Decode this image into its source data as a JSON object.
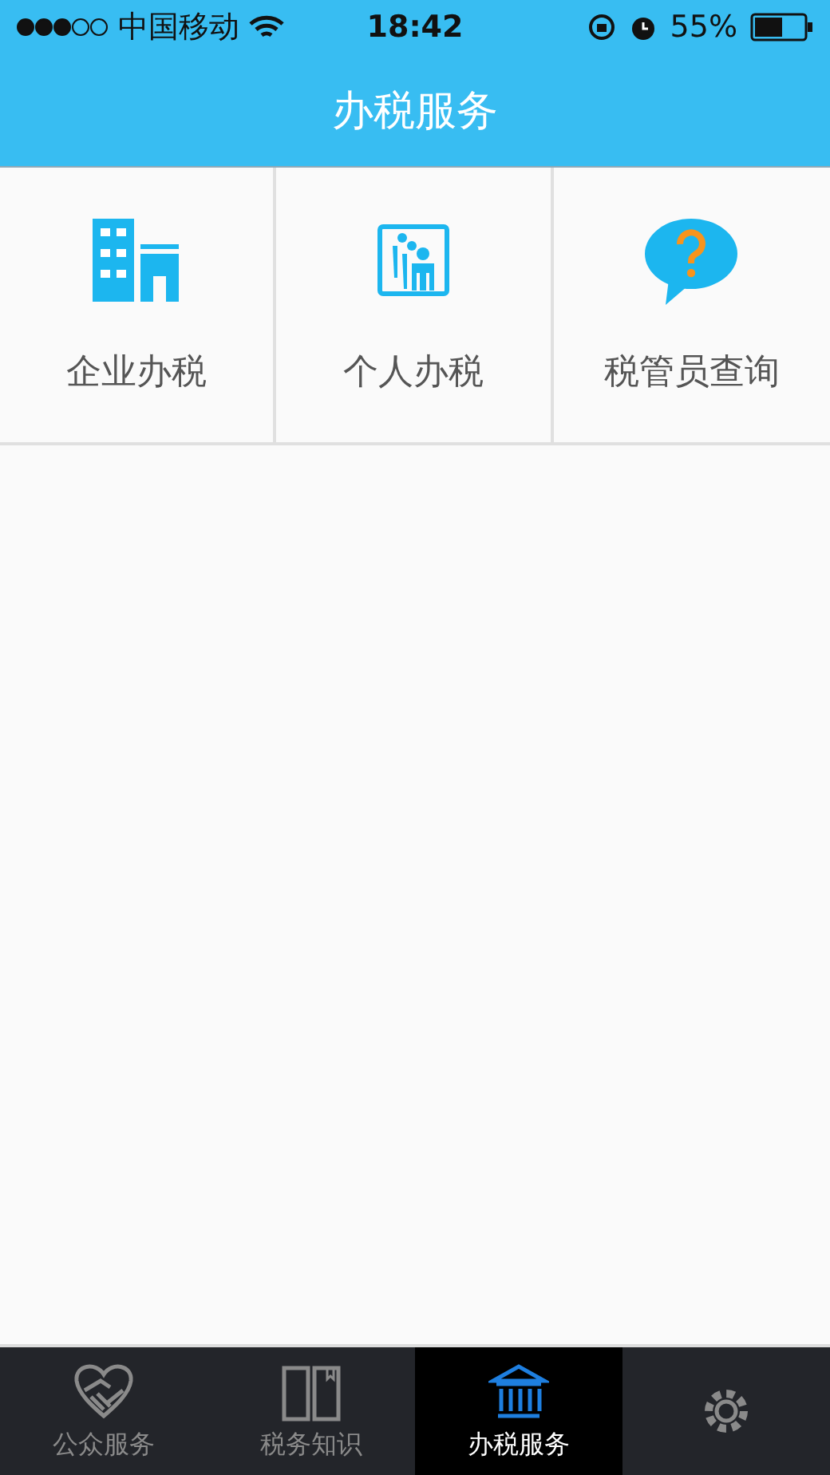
{
  "status_bar": {
    "carrier": "中国移动",
    "time": "18:42",
    "battery": "55%"
  },
  "header": {
    "title": "办税服务"
  },
  "services": [
    {
      "label": "企业办税",
      "kind": "building"
    },
    {
      "label": "个人办税",
      "kind": "people"
    },
    {
      "label": "税管员查询",
      "kind": "question"
    }
  ],
  "tab_bar": [
    {
      "label": "公众服务",
      "kind": "handshake",
      "selected": false
    },
    {
      "label": "税务知识",
      "kind": "book",
      "selected": false
    },
    {
      "label": "办税服务",
      "kind": "bank",
      "selected": true
    },
    {
      "kind": "gear",
      "selected": false
    }
  ]
}
